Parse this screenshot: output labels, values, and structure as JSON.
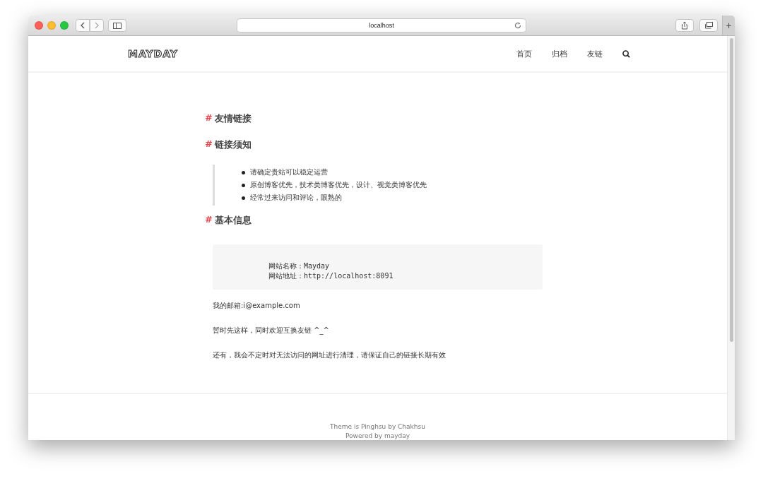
{
  "browser": {
    "address": "localhost",
    "new_tab": "+"
  },
  "site": {
    "logo": "MAYDAY",
    "nav": [
      {
        "label": "首页"
      },
      {
        "label": "归档"
      },
      {
        "label": "友链"
      }
    ]
  },
  "sections": [
    {
      "kind": "heading",
      "marker": "#",
      "text": "友情链接"
    },
    {
      "kind": "heading",
      "marker": "#",
      "text": "链接须知"
    },
    {
      "kind": "quote_list",
      "items": [
        "请确定贵站可以稳定运营",
        "原创博客优先，技术类博客优先，设计、视觉类博客优先",
        "经常过来访问和评论，眼熟的"
      ]
    },
    {
      "kind": "heading",
      "marker": "#",
      "text": "基本信息"
    },
    {
      "kind": "code",
      "lines": [
        "网站名称：Mayday",
        "网站地址：http://localhost:8091"
      ]
    },
    {
      "kind": "paragraph",
      "text": "我的邮箱:i@example.com"
    },
    {
      "kind": "paragraph",
      "text": "暂时先这样，同时欢迎互换友链 ^_^"
    },
    {
      "kind": "paragraph",
      "text": "还有，我会不定时对无法访问的网址进行清理，请保证自己的链接长期有效"
    }
  ],
  "footer": [
    "Theme is Pinghsu by Chakhsu",
    "Powered by mayday"
  ]
}
